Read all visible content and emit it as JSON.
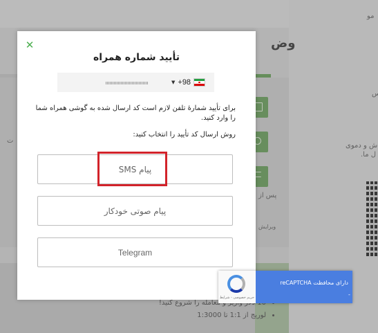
{
  "background": {
    "title_fragment": "وض",
    "text_fragments": [
      "مو",
      "س",
      "ش و دموی",
      "ل ما.",
      "ت",
      "پس از",
      "ویرایش"
    ],
    "list_items": [
      "10 دلار واریز و معامله را شروع کنید!",
      "لوریج از 1:1 تا 1:3000"
    ]
  },
  "modal": {
    "title": "تأیید شماره همراه",
    "country_code": "+98",
    "phone_value": "",
    "description": "برای تأیید شمارهٔ تلفن لازم است کد ارسال شده به گوشی همراه شما را وارد کنید.",
    "choose_label": "روش ارسال کد تأیید را انتخاب کنید:",
    "options": [
      {
        "label": "پیام SMS"
      },
      {
        "label": "پیام صوتی خودکار"
      },
      {
        "label": "Telegram"
      }
    ]
  },
  "recaptcha": {
    "text": "دارای محافظت reCAPTCHA",
    "links": "حریم خصوصی - شرایط",
    "dash": "-"
  },
  "colors": {
    "accent_green": "#4caf50",
    "highlight_red": "#d2232a",
    "recaptcha_blue": "#4a7ee0"
  }
}
